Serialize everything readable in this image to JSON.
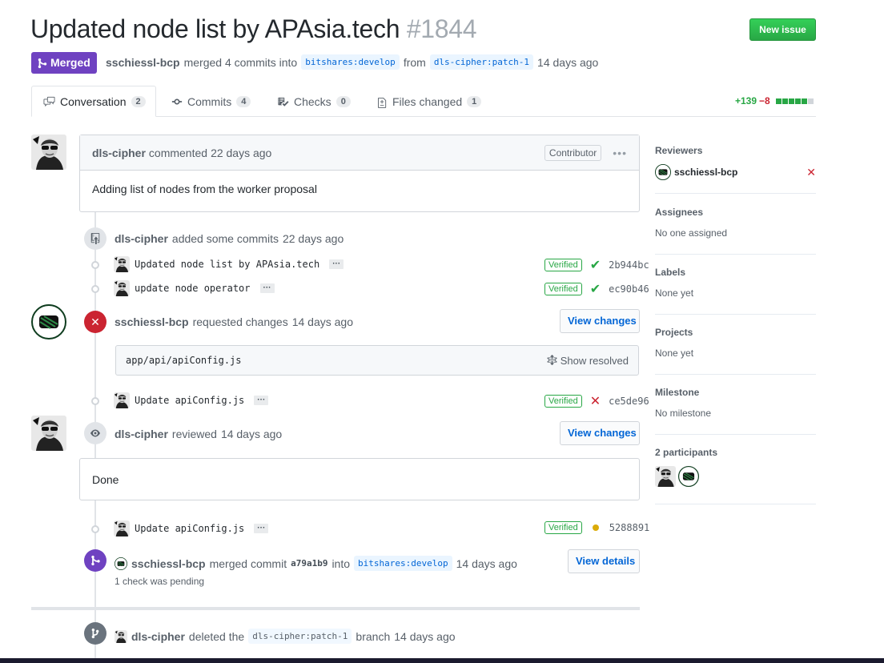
{
  "header": {
    "title": "Updated node list by APAsia.tech",
    "number": "#1844",
    "new_issue": "New issue",
    "state": "Merged",
    "author": "sschiessl-bcp",
    "merge_text": "merged 4 commits into",
    "base_branch": "bitshares:develop",
    "from_text": "from",
    "head_branch": "dls-cipher:patch-1",
    "time": "14 days ago"
  },
  "tabs": [
    {
      "label": "Conversation",
      "count": "2",
      "icon": "comment-discussion-icon"
    },
    {
      "label": "Commits",
      "count": "4",
      "icon": "git-commit-icon"
    },
    {
      "label": "Checks",
      "count": "0",
      "icon": "checklist-icon"
    },
    {
      "label": "Files changed",
      "count": "1",
      "icon": "file-diff-icon"
    }
  ],
  "diffstat": {
    "additions": "+139",
    "deletions": "−8",
    "boxes": [
      "added",
      "added",
      "added",
      "added",
      "added",
      "neutral"
    ]
  },
  "colors": {
    "merged": "#6f42c1",
    "green": "#28a745",
    "red": "#cb2431",
    "link": "#0366d6"
  },
  "timeline": {
    "comment1": {
      "author": "dls-cipher",
      "action": "commented",
      "time": "22 days ago",
      "role": "Contributor",
      "body": "Adding list of nodes from the worker proposal"
    },
    "commits_event": {
      "author": "dls-cipher",
      "action": "added some commits",
      "time": "22 days ago"
    },
    "commits1": [
      {
        "message": "Updated node list by APAsia.tech",
        "verified": "Verified",
        "status": "success",
        "sha": "2b944bc"
      },
      {
        "message": "update node operator",
        "verified": "Verified",
        "status": "success",
        "sha": "ec90b46"
      }
    ],
    "review1": {
      "author": "sschiessl-bcp",
      "action": "requested changes",
      "time": "14 days ago",
      "button": "View changes"
    },
    "file": {
      "path": "app/api/apiConfig.js",
      "show_resolved": "Show resolved"
    },
    "commit3": {
      "message": "Update apiConfig.js",
      "verified": "Verified",
      "status": "failure",
      "sha": "ce5de96"
    },
    "review2": {
      "author": "dls-cipher",
      "action": "reviewed",
      "time": "14 days ago",
      "button": "View changes",
      "body": "Done"
    },
    "commit4": {
      "message": "Update apiConfig.js",
      "verified": "Verified",
      "status": "pending",
      "sha": "5288891"
    },
    "merge": {
      "author": "sschiessl-bcp",
      "action": "merged commit",
      "sha": "a79a1b9",
      "into": "into",
      "branch": "bitshares:develop",
      "time": "14 days ago",
      "button": "View details",
      "checks": "1 check was pending"
    },
    "deleted": {
      "author": "dls-cipher",
      "action": "deleted the",
      "branch": "dls-cipher:patch-1",
      "suffix": "branch",
      "time": "14 days ago"
    }
  },
  "sidebar": {
    "reviewers": {
      "title": "Reviewers",
      "name": "sschiessl-bcp"
    },
    "assignees": {
      "title": "Assignees",
      "value": "No one assigned"
    },
    "labels": {
      "title": "Labels",
      "value": "None yet"
    },
    "projects": {
      "title": "Projects",
      "value": "None yet"
    },
    "milestone": {
      "title": "Milestone",
      "value": "No milestone"
    },
    "participants": {
      "title": "2 participants"
    }
  }
}
